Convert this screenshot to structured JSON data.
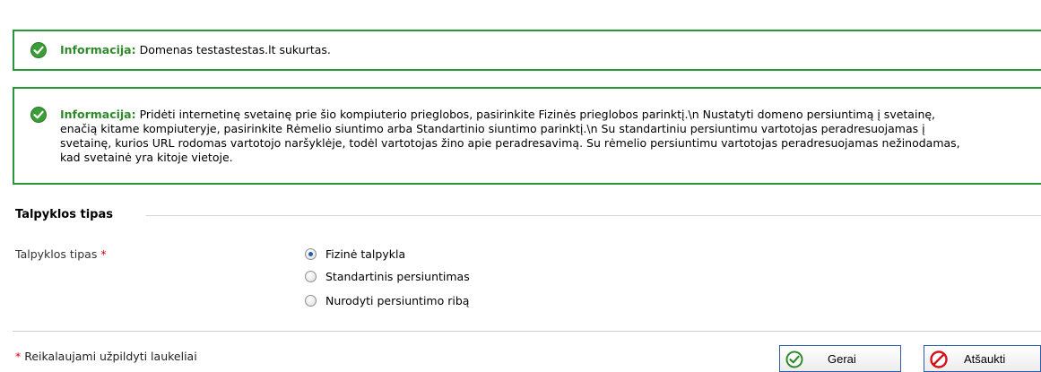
{
  "messages": [
    {
      "label": "Informacija:",
      "text": "Domenas testastestas.lt sukurtas."
    },
    {
      "label": "Informacija:",
      "text": "Pridėti internetinę svetainę prie šio kompiuterio prieglobos, pasirinkite Fizinės prieglobos parinktį.\\n Nustatyti domeno persiuntimą į svetainę, enačią kitame kompiuteryje, pasirinkite Rėmelio siuntimo arba Standartinio siuntimo parinktį.\\n Su standartiniu persiuntimu vartotojas peradresuojamas į svetainę, kurios URL rodomas vartotojo naršyklėje, todėl vartotojas žino apie peradresavimą. Su rėmelio persiuntimu vartotojas peradresuojamas nežinodamas, kad svetainė yra kitoje vietoje."
    }
  ],
  "section": {
    "title": "Talpyklos tipas"
  },
  "field": {
    "label": "Talpyklos tipas",
    "required_mark": "*",
    "options": [
      {
        "label": "Fizinė talpykla",
        "checked": true
      },
      {
        "label": "Standartinis persiuntimas",
        "checked": false
      },
      {
        "label": "Nurodyti persiuntimo ribą",
        "checked": false
      }
    ]
  },
  "footer": {
    "required_mark": "*",
    "note": "Reikalaujami užpildyti laukeliai"
  },
  "buttons": {
    "ok_label": "Gerai",
    "cancel_label": "Atšaukti"
  },
  "colors": {
    "success_border": "#29963c",
    "info_label": "#2e8b2a",
    "required": "#d9000d",
    "button_border": "#2a5ea8"
  }
}
